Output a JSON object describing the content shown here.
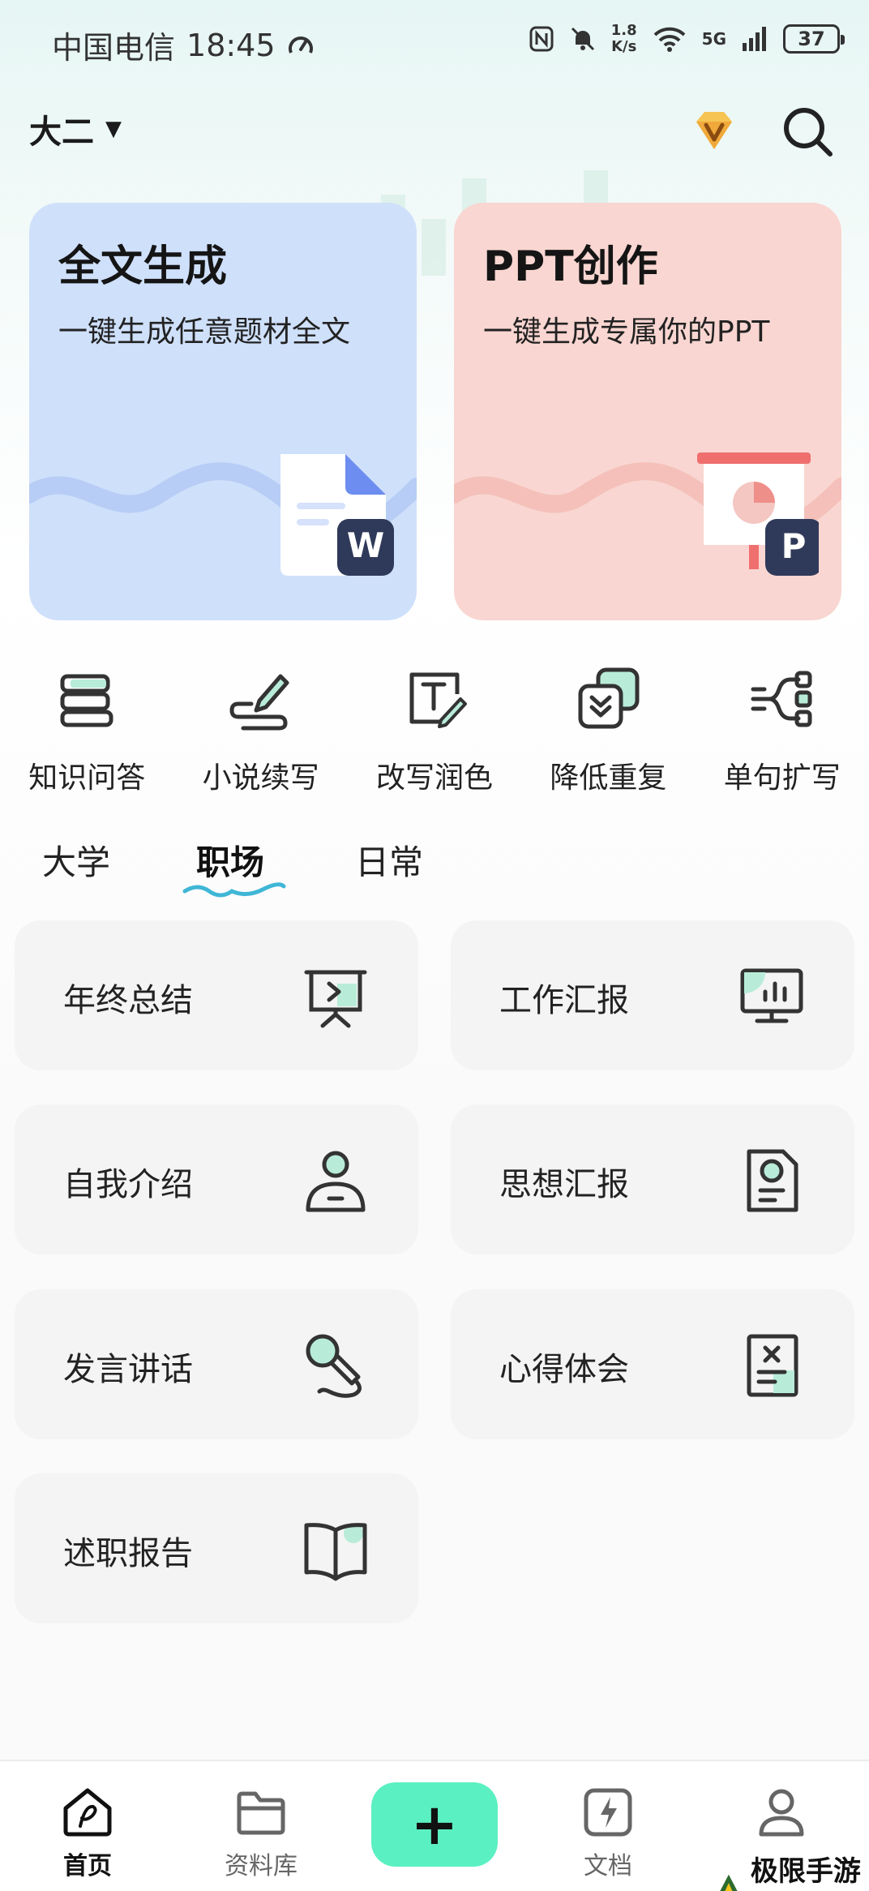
{
  "status_bar": {
    "carrier": "中国电信",
    "time": "18:45",
    "speed_value": "1.8",
    "speed_unit": "K/s",
    "network": "5G",
    "battery": "37"
  },
  "header": {
    "grade": "大二",
    "vip_icon": "diamond-v-icon",
    "search_icon": "search-icon"
  },
  "cards": [
    {
      "title": "全文生成",
      "subtitle": "一键生成任意题材全文",
      "badge": "W",
      "color": "#cfe0fb"
    },
    {
      "title": "PPT创作",
      "subtitle": "一键生成专属你的PPT",
      "badge": "P",
      "color": "#f9d6d1"
    }
  ],
  "tools": [
    {
      "label": "知识问答",
      "icon": "books-icon"
    },
    {
      "label": "小说续写",
      "icon": "pen-scribble-icon"
    },
    {
      "label": "改写润色",
      "icon": "text-edit-icon"
    },
    {
      "label": "降低重复",
      "icon": "layers-down-icon"
    },
    {
      "label": "单句扩写",
      "icon": "expand-lines-icon"
    }
  ],
  "tabs": [
    {
      "label": "大学",
      "active": false
    },
    {
      "label": "职场",
      "active": true
    },
    {
      "label": "日常",
      "active": false
    }
  ],
  "items": [
    {
      "label": "年终总结",
      "icon": "presentation-board-icon"
    },
    {
      "label": "工作汇报",
      "icon": "chart-monitor-icon"
    },
    {
      "label": "自我介绍",
      "icon": "person-icon"
    },
    {
      "label": "思想汇报",
      "icon": "document-badge-icon"
    },
    {
      "label": "发言讲话",
      "icon": "microphone-icon"
    },
    {
      "label": "心得体会",
      "icon": "note-icon"
    },
    {
      "label": "述职报告",
      "icon": "open-book-icon"
    }
  ],
  "bottom_nav": [
    {
      "label": "首页",
      "icon": "home-icon",
      "active": true
    },
    {
      "label": "资料库",
      "icon": "folder-icon",
      "active": false
    },
    {
      "label": "+",
      "icon": "plus-icon",
      "active": false
    },
    {
      "label": "文档",
      "icon": "document-bolt-icon",
      "active": false
    },
    {
      "label": "",
      "icon": "profile-icon",
      "active": false
    }
  ],
  "watermark": "极限手游网",
  "colors": {
    "accent": "#5bf0c1",
    "icon_fill": "#b8ecd9",
    "tab_underline": "#3fb6d6"
  }
}
